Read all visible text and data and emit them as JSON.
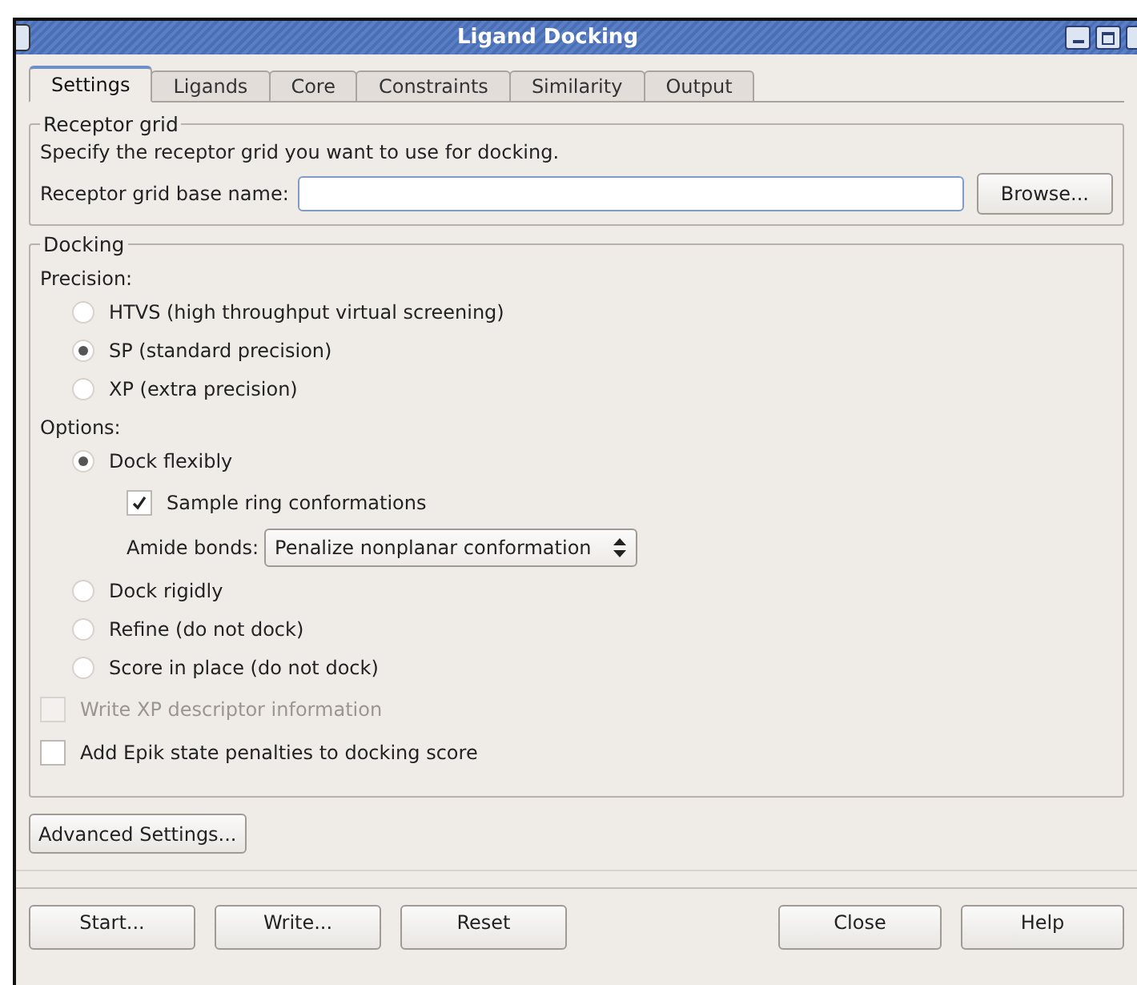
{
  "window": {
    "title": "Ligand Docking"
  },
  "tabs": [
    {
      "label": "Settings",
      "selected": true
    },
    {
      "label": "Ligands",
      "selected": false
    },
    {
      "label": "Core",
      "selected": false
    },
    {
      "label": "Constraints",
      "selected": false
    },
    {
      "label": "Similarity",
      "selected": false
    },
    {
      "label": "Output",
      "selected": false
    }
  ],
  "receptor_grid": {
    "legend": "Receptor grid",
    "description": "Specify the receptor grid you want to use for docking.",
    "field_label": "Receptor grid base name:",
    "browse_button": "Browse..."
  },
  "docking": {
    "legend": "Docking",
    "precision_label": "Precision:",
    "precision": [
      {
        "label": "HTVS (high throughput virtual screening)",
        "selected": false
      },
      {
        "label": "SP (standard precision)",
        "selected": true
      },
      {
        "label": "XP (extra precision)",
        "selected": false
      }
    ],
    "options_label": "Options:",
    "options": [
      {
        "label": "Dock flexibly",
        "selected": true,
        "children": [
          {
            "kind": "checkbox",
            "label": "Sample ring conformations",
            "checked": true
          },
          {
            "kind": "select",
            "label": "Amide bonds:",
            "value": "Penalize nonplanar conformation"
          }
        ]
      },
      {
        "label": "Dock rigidly",
        "selected": false
      },
      {
        "label": "Refine (do not dock)",
        "selected": false
      },
      {
        "label": "Score in place (do not dock)",
        "selected": false
      }
    ],
    "checks": [
      {
        "label": "Write XP descriptor information",
        "checked": false,
        "disabled": true
      },
      {
        "label": "Add Epik state penalties to docking score",
        "checked": false,
        "disabled": false
      }
    ]
  },
  "advanced_button": "Advanced Settings...",
  "left_buttons": [
    "Start...",
    "Write...",
    "Reset"
  ],
  "right_buttons": [
    "Close",
    "Help"
  ]
}
